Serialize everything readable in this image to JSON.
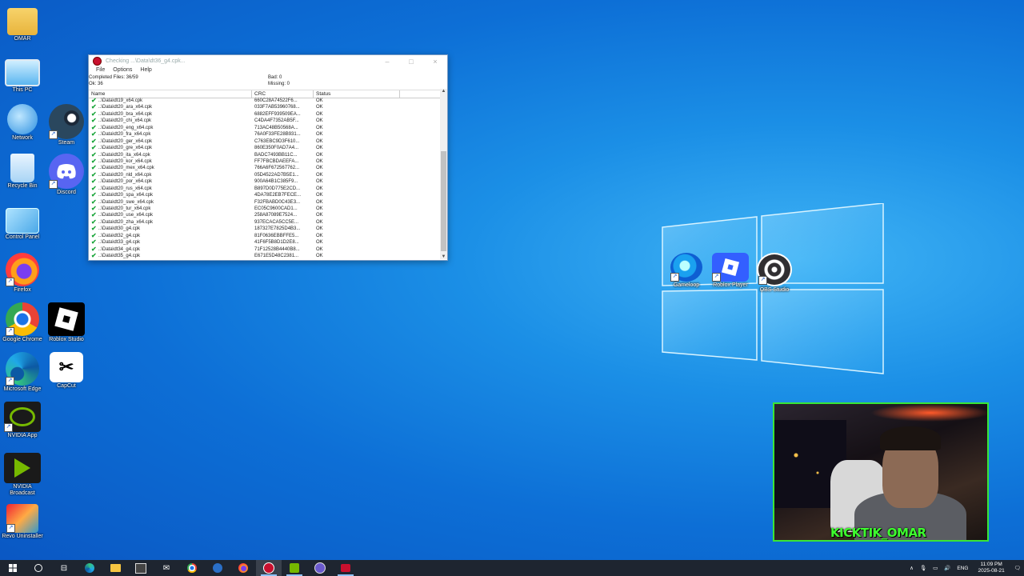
{
  "desktop": {
    "icons_left": [
      {
        "label": "OMAR",
        "icon": "user-folder-icon"
      },
      {
        "label": "This PC",
        "icon": "computer-icon"
      },
      {
        "label": "Network",
        "icon": "network-icon"
      },
      {
        "label": "Steam",
        "icon": "steam-icon"
      },
      {
        "label": "Recycle Bin",
        "icon": "recycle-bin-icon"
      },
      {
        "label": "Discord",
        "icon": "discord-icon"
      },
      {
        "label": "Control Panel",
        "icon": "control-panel-icon"
      },
      {
        "label": "Firefox",
        "icon": "firefox-icon"
      },
      {
        "label": "Google Chrome",
        "icon": "chrome-icon"
      },
      {
        "label": "Roblox Studio",
        "icon": "roblox-studio-icon"
      },
      {
        "label": "Microsoft Edge",
        "icon": "edge-icon"
      },
      {
        "label": "CapCut",
        "icon": "capcut-icon"
      },
      {
        "label": "NVIDIA App",
        "icon": "nvidia-icon"
      },
      {
        "label": "NVIDIA Broadcast",
        "icon": "nvidia-broadcast-icon"
      },
      {
        "label": "Revo Uninstaller",
        "icon": "revo-icon"
      }
    ],
    "icons_right": [
      {
        "label": "Gameloop",
        "icon": "gameloop-icon"
      },
      {
        "label": "Roblox Player",
        "icon": "roblox-player-icon"
      },
      {
        "label": "OBS Studio",
        "icon": "obs-icon"
      }
    ]
  },
  "window": {
    "title": "Checking ...\\Data\\dt36_g4.cpk...",
    "menu": [
      "File",
      "Options",
      "Help"
    ],
    "stats": {
      "completed": "Completed Files: 36/59",
      "ok": "Ok: 36",
      "bad": "Bad: 0",
      "missing": "Missing: 0"
    },
    "columns": [
      "Name",
      "CRC",
      "Status"
    ],
    "rows": [
      {
        "name": "..\\Data\\dt19_x64.cpk",
        "crc": "660C28A74522F6...",
        "status": "OK"
      },
      {
        "name": "..\\Data\\dt20_ara_x64.cpk",
        "crc": "033F7AB53960768...",
        "status": "OK"
      },
      {
        "name": "..\\Data\\dt20_bra_x64.cpk",
        "crc": "6882EFF939509EA...",
        "status": "OK"
      },
      {
        "name": "..\\Data\\dt20_chi_x64.cpk",
        "crc": "C4DA4F7352AB5F...",
        "status": "OK"
      },
      {
        "name": "..\\Data\\dt20_eng_x64.cpk",
        "crc": "713AC48B50568A...",
        "status": "OK"
      },
      {
        "name": "..\\Data\\dt20_fra_x64.cpk",
        "crc": "76A0F33FE28B931...",
        "status": "OK"
      },
      {
        "name": "..\\Data\\dt20_ger_x64.cpk",
        "crc": "C763EBC9D3F610...",
        "status": "OK"
      },
      {
        "name": "..\\Data\\dt20_gre_x64.cpk",
        "crc": "860E350F0AD7A4...",
        "status": "OK"
      },
      {
        "name": "..\\Data\\dt20_ita_x64.cpk",
        "crc": "BADC7493BB11C...",
        "status": "OK"
      },
      {
        "name": "..\\Data\\dt20_kor_x64.cpk",
        "crc": "FF7FBCBDAEEFA...",
        "status": "OK"
      },
      {
        "name": "..\\Data\\dt20_mex_x64.cpk",
        "crc": "766A6F672567762...",
        "status": "OK"
      },
      {
        "name": "..\\Data\\dt20_nld_x64.cpk",
        "crc": "05D4522AD7B5E1...",
        "status": "OK"
      },
      {
        "name": "..\\Data\\dt20_por_x64.cpk",
        "crc": "900A64B1C385F9...",
        "status": "OK"
      },
      {
        "name": "..\\Data\\dt20_rus_x64.cpk",
        "crc": "B897D0D775E2CD...",
        "status": "OK"
      },
      {
        "name": "..\\Data\\dt20_spa_x64.cpk",
        "crc": "4DA78E2EB7FECE...",
        "status": "OK"
      },
      {
        "name": "..\\Data\\dt20_swe_x64.cpk",
        "crc": "F32FBABD0C43E3...",
        "status": "OK"
      },
      {
        "name": "..\\Data\\dt20_tur_x64.cpk",
        "crc": "EC05C9600CAD1...",
        "status": "OK"
      },
      {
        "name": "..\\Data\\dt20_use_x64.cpk",
        "crc": "258A87089E7524...",
        "status": "OK"
      },
      {
        "name": "..\\Data\\dt20_zha_x64.cpk",
        "crc": "937ECACA5CC5E...",
        "status": "OK"
      },
      {
        "name": "..\\Data\\dt30_g4.cpk",
        "crc": "187327E7825D4B3...",
        "status": "OK"
      },
      {
        "name": "..\\Data\\dt32_g4.cpk",
        "crc": "81F0636EBBFFE5...",
        "status": "OK"
      },
      {
        "name": "..\\Data\\dt33_g4.cpk",
        "crc": "41F6F5B8D1D2E8...",
        "status": "OK"
      },
      {
        "name": "..\\Data\\dt34_g4.cpk",
        "crc": "71F12528B4440B8...",
        "status": "OK"
      },
      {
        "name": "..\\Data\\dt35_g4.cpk",
        "crc": "E671E5D48C2381...",
        "status": "OK"
      }
    ]
  },
  "webcam": {
    "overlay_text": "KICKTIK_OMAR"
  },
  "taskbar": {
    "items": [
      "start-icon",
      "search-icon",
      "task-view-icon",
      "edge-icon",
      "file-explorer-icon",
      "store-icon",
      "mail-icon",
      "chrome-icon",
      "steam-icon",
      "firefox-icon",
      "pes-checker-icon",
      "nvidia-icon",
      "obs-icon",
      "pes-icon"
    ],
    "tray": {
      "lang": "ENG",
      "time": "11:09 PM",
      "date": "2025-08-21"
    }
  }
}
